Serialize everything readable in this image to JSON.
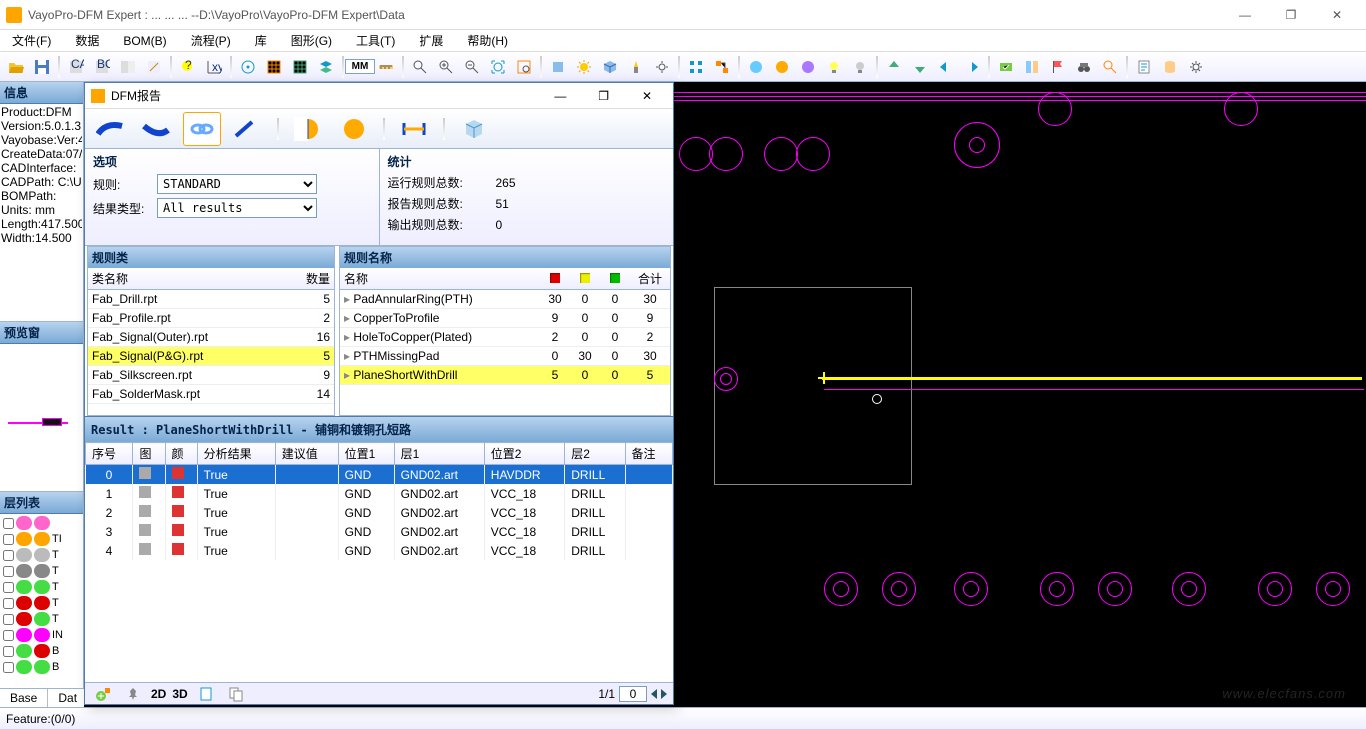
{
  "window": {
    "title": "VayoPro-DFM Expert : ... ... ... --D:\\VayoPro\\VayoPro-DFM Expert\\Data",
    "min": "—",
    "max": "❐",
    "close": "✕"
  },
  "menu": [
    "文件(F)",
    "数据",
    "BOM(B)",
    "流程(P)",
    "库",
    "图形(G)",
    "工具(T)",
    "扩展",
    "帮助(H)"
  ],
  "mm_label": "MM",
  "info": {
    "header": "信息",
    "lines": [
      "Product:DFM",
      "Version:5.0.1.3",
      "Vayobase:Ver:4",
      "CreateData:07/",
      "CADInterface:",
      "CADPath: C:\\U",
      "BOMPath:",
      "Units: mm",
      "Length:417.500",
      "Width:14.500"
    ]
  },
  "preview": {
    "header": "预览窗"
  },
  "layers": {
    "header": "层列表",
    "rows": [
      {
        "c1": "#ff66cc",
        "c2": "#ff66cc",
        "nm": ""
      },
      {
        "c1": "#ffa500",
        "c2": "#ffa500",
        "nm": "TI"
      },
      {
        "c1": "#bbbbbb",
        "c2": "#bbbbbb",
        "nm": "T"
      },
      {
        "c1": "#888888",
        "c2": "#888888",
        "nm": "T"
      },
      {
        "c1": "#44dd44",
        "c2": "#44dd44",
        "nm": "T"
      },
      {
        "c1": "#dd0000",
        "c2": "#dd0000",
        "nm": "T"
      },
      {
        "c1": "#dd0000",
        "c2": "#44dd44",
        "nm": "T"
      },
      {
        "c1": "#ff00ff",
        "c2": "#ff00ff",
        "nm": "IN"
      },
      {
        "c1": "#44dd44",
        "c2": "#dd0000",
        "nm": "B"
      },
      {
        "c1": "#44dd44",
        "c2": "#44dd44",
        "nm": "B"
      }
    ],
    "tabs": [
      "Base",
      "Dat"
    ]
  },
  "status": {
    "feature": "Feature:(0/0)"
  },
  "dfm": {
    "title": "DFM报告",
    "min": "—",
    "max": "❐",
    "close": "✕",
    "opts": {
      "hdr": "选项",
      "rule_label": "规则:",
      "rule_value": "STANDARD",
      "resulttype_label": "结果类型:",
      "resulttype_value": "All results"
    },
    "stats": {
      "hdr": "统计",
      "rows": [
        {
          "lbl": "运行规则总数:",
          "val": "265"
        },
        {
          "lbl": "报告规则总数:",
          "val": "51"
        },
        {
          "lbl": "输出规则总数:",
          "val": "0"
        }
      ]
    },
    "ruleClasses": {
      "hdr": "规则类",
      "cols": [
        "类名称",
        "数量"
      ],
      "rows": [
        {
          "name": "Fab_Drill.rpt",
          "cnt": "5"
        },
        {
          "name": "Fab_Profile.rpt",
          "cnt": "2"
        },
        {
          "name": "Fab_Signal(Outer).rpt",
          "cnt": "16"
        },
        {
          "name": "Fab_Signal(P&G).rpt",
          "cnt": "5",
          "sel": true
        },
        {
          "name": "Fab_Silkscreen.rpt",
          "cnt": "9"
        },
        {
          "name": "Fab_SolderMask.rpt",
          "cnt": "14"
        }
      ]
    },
    "ruleNames": {
      "hdr": "规则名称",
      "cols": [
        "名称",
        "",
        "",
        "",
        "合计"
      ],
      "rows": [
        {
          "name": "PadAnnularRing(PTH)",
          "r": "30",
          "y": "0",
          "g": "0",
          "t": "30"
        },
        {
          "name": "CopperToProfile",
          "r": "9",
          "y": "0",
          "g": "0",
          "t": "9"
        },
        {
          "name": "HoleToCopper(Plated)",
          "r": "2",
          "y": "0",
          "g": "0",
          "t": "2"
        },
        {
          "name": "PTHMissingPad",
          "r": "0",
          "y": "30",
          "g": "0",
          "t": "30"
        },
        {
          "name": "PlaneShortWithDrill",
          "r": "5",
          "y": "0",
          "g": "0",
          "t": "5",
          "sel": true
        }
      ]
    },
    "result": {
      "title": "Result : PlaneShortWithDrill - 铺铜和镀铜孔短路",
      "cols": [
        "序号",
        "图",
        "颜",
        "分析结果",
        "建议值",
        "位置1",
        "层1",
        "位置2",
        "层2",
        "备注"
      ],
      "rows": [
        {
          "n": "0",
          "ar": "True",
          "sv": "",
          "p1": "GND",
          "l1": "GND02.art",
          "p2": "HAVDDR",
          "l2": "DRILL",
          "sel": true
        },
        {
          "n": "1",
          "ar": "True",
          "sv": "",
          "p1": "GND",
          "l1": "GND02.art",
          "p2": "VCC_18",
          "l2": "DRILL"
        },
        {
          "n": "2",
          "ar": "True",
          "sv": "",
          "p1": "GND",
          "l1": "GND02.art",
          "p2": "VCC_18",
          "l2": "DRILL"
        },
        {
          "n": "3",
          "ar": "True",
          "sv": "",
          "p1": "GND",
          "l1": "GND02.art",
          "p2": "VCC_18",
          "l2": "DRILL"
        },
        {
          "n": "4",
          "ar": "True",
          "sv": "",
          "p1": "GND",
          "l1": "GND02.art",
          "p2": "VCC_18",
          "l2": "DRILL"
        }
      ]
    },
    "bottom": {
      "view2d": "2D",
      "view3d": "3D",
      "page": "1/1",
      "page_input": "0"
    }
  },
  "watermark": "www.elecfans.com"
}
